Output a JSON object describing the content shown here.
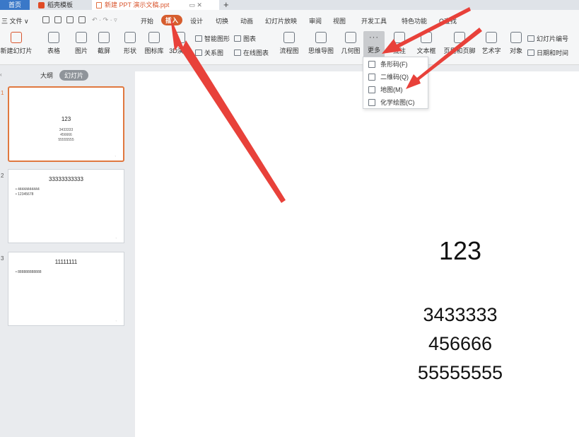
{
  "tabs": {
    "home": "首页",
    "template": "稻壳模板",
    "document": "新建 PPT 演示文稿.ppt",
    "new_tab": "+"
  },
  "menu": {
    "file": "三 文件 ∨",
    "items": [
      "开始",
      "插入",
      "设计",
      "切换",
      "动画",
      "幻灯片放映",
      "审阅",
      "视图",
      "开发工具",
      "特色功能"
    ],
    "search": "Q查找"
  },
  "ribbon": {
    "new_slide": "新建幻灯片",
    "table": "表格",
    "picture": "图片",
    "screenshot": "截屏",
    "shape": "形状",
    "icon_library": "图标库",
    "demo_3d": "3D演示",
    "smart_graphic": "智能图形",
    "chart": "图表",
    "relation_graph": "关系图",
    "online_chart": "在线图表",
    "flowchart": "流程图",
    "mind_map": "思维导图",
    "geometry": "几何图",
    "more": "更多",
    "comment": "批注",
    "text_box": "文本框",
    "header_footer": "页眉和页脚",
    "word_art": "艺术字",
    "object": "对象",
    "slide_number": "幻灯片编号",
    "date_time": "日期和时间"
  },
  "dropdown": {
    "items": [
      "条形码(F)",
      "二维码(Q)",
      "地图(M)",
      "化学绘图(C)"
    ]
  },
  "left_panel": {
    "outline_tab": "大纲",
    "slides_tab": "幻灯片",
    "slides": [
      {
        "number": "1",
        "title": "123",
        "lines": [
          "3433333",
          "456666",
          "55555555"
        ]
      },
      {
        "number": "2",
        "title": "33333333333",
        "bullets": [
          "44444444444",
          "12345678"
        ]
      },
      {
        "number": "3",
        "title": "11111111",
        "bullets": [
          "888888888888"
        ]
      }
    ]
  },
  "canvas": {
    "title": "123",
    "lines": [
      "3433333",
      "456666",
      "55555555"
    ]
  },
  "colors": {
    "accent": "#d9552d",
    "arrow": "#e8413a",
    "active_tab": "#3a78c8"
  }
}
